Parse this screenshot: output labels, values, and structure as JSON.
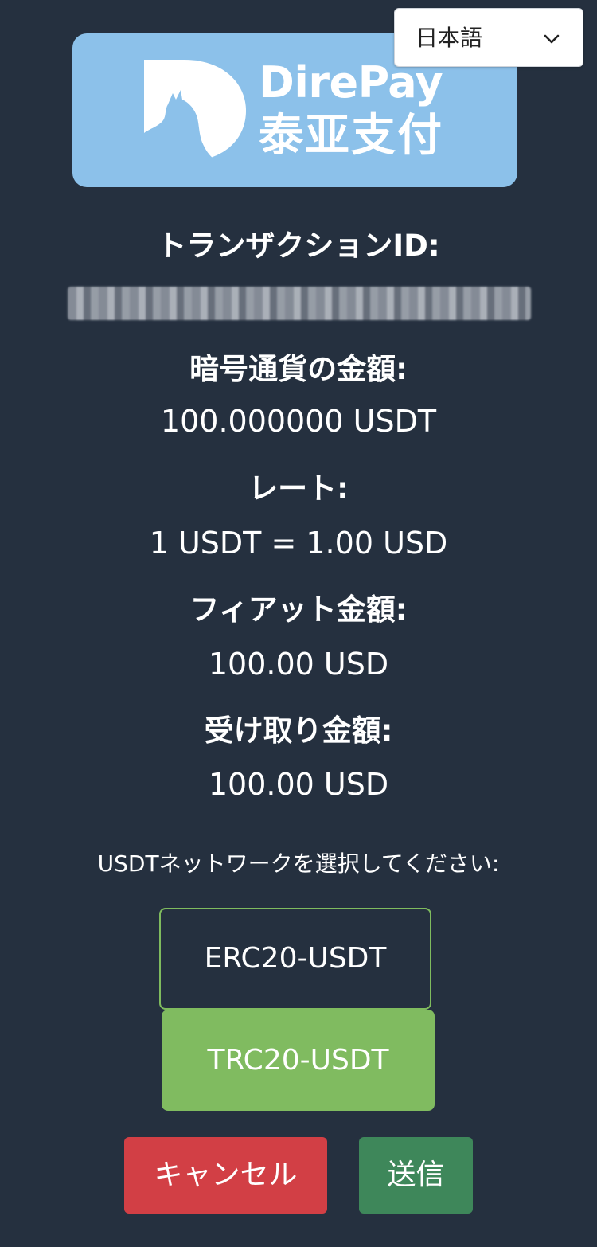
{
  "language_select": {
    "value": "日本語",
    "chevron_icon": "chevron-down-icon"
  },
  "logo": {
    "title": "DirePay",
    "subtitle": "泰亚支付",
    "mark_icon": "wolf-howling-icon",
    "background_color": "#8cc1ea"
  },
  "transaction": {
    "id_label": "トランザクションID:",
    "id_value_state": "blurred"
  },
  "crypto_amount": {
    "label": "暗号通貨の金額:",
    "value": "100.000000 USDT"
  },
  "rate": {
    "label": "レート:",
    "value": "1 USDT = 1.00 USD"
  },
  "fiat_amount": {
    "label": "フィアット金額:",
    "value": "100.00 USD"
  },
  "received_amount": {
    "label": "受け取り金額:",
    "value": "100.00 USD"
  },
  "network": {
    "prompt": "USDTネットワークを選択してください:",
    "options": [
      {
        "label": "ERC20-USDT",
        "selected": false
      },
      {
        "label": "TRC20-USDT",
        "selected": true
      }
    ],
    "accent_color": "#80bb60"
  },
  "actions": {
    "cancel_label": "キャンセル",
    "submit_label": "送信",
    "cancel_color": "#d23f45",
    "submit_color": "#3e875a"
  },
  "colors": {
    "background": "#25303f",
    "text": "#ffffff"
  }
}
